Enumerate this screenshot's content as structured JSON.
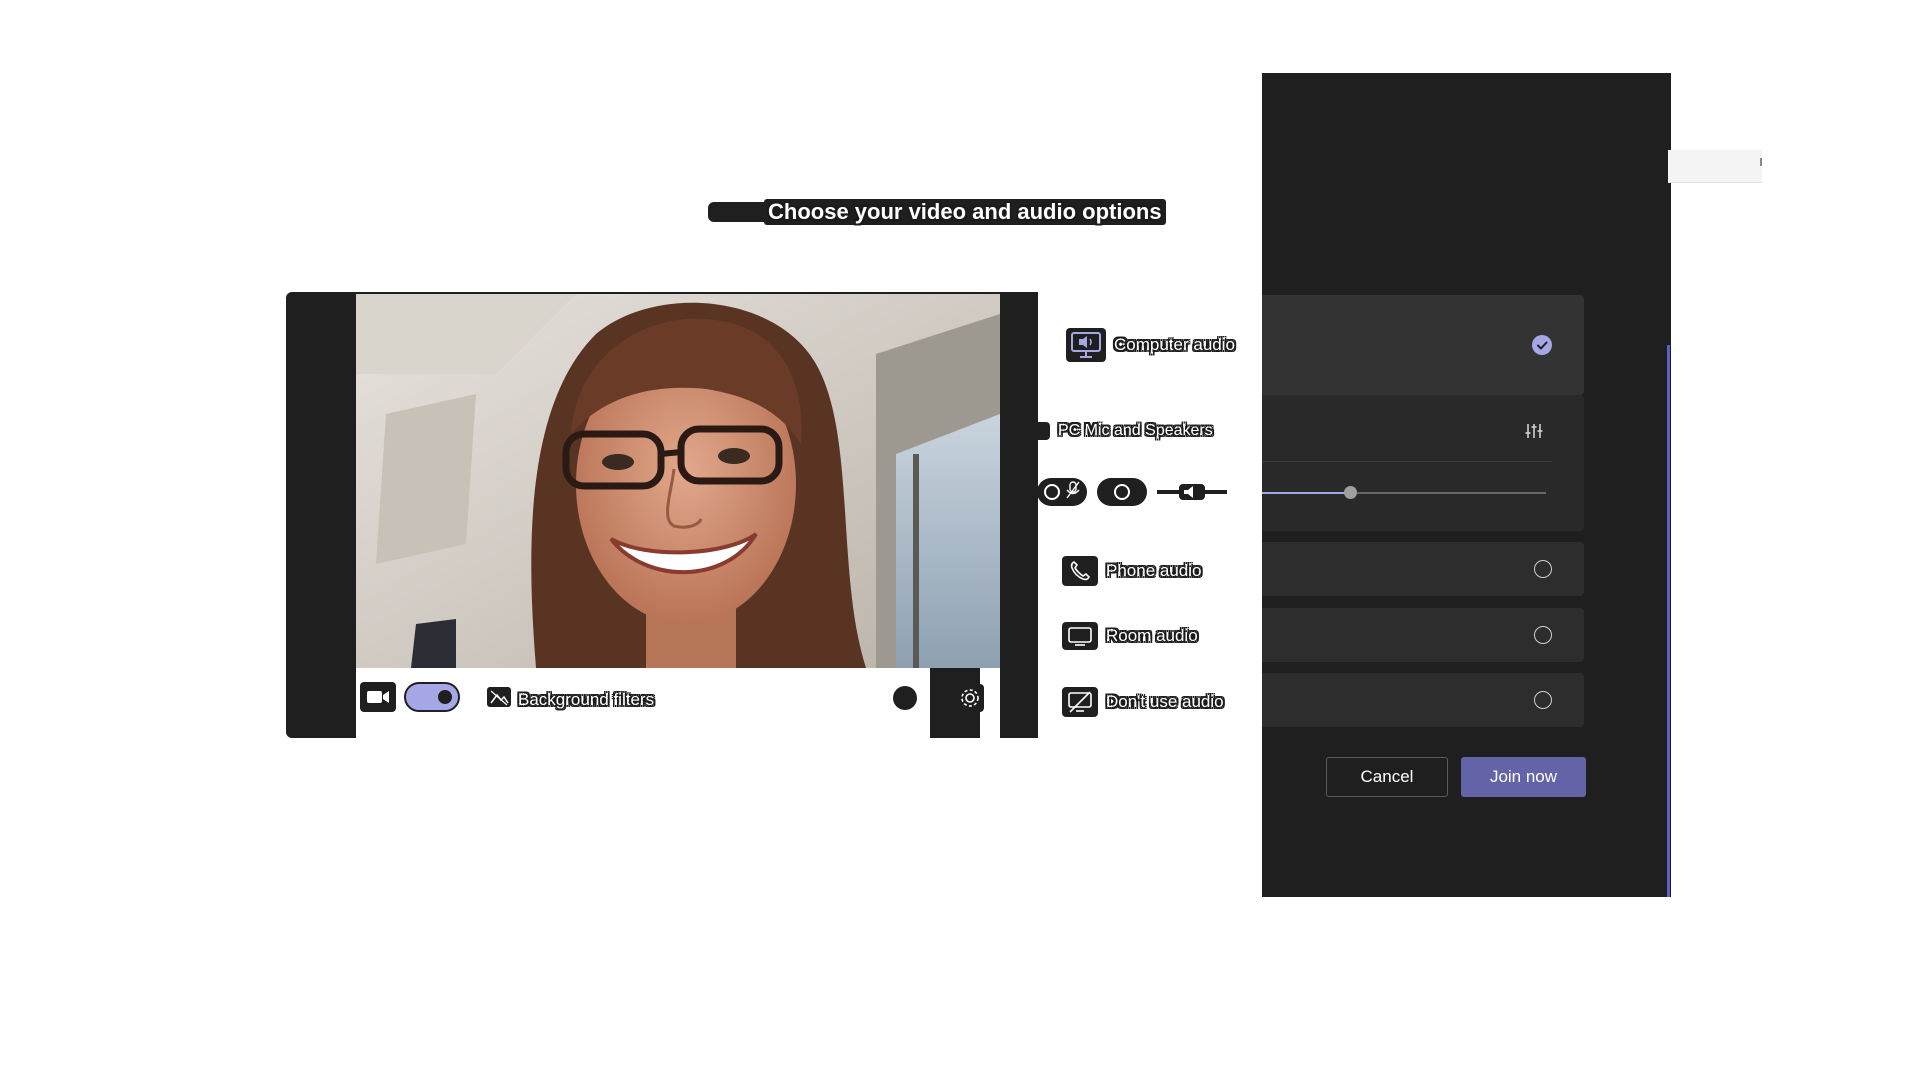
{
  "title": "Choose your video and audio options",
  "video": {
    "background_filters_label": "Background filters",
    "camera_on": true
  },
  "audio_options": {
    "computer_audio": {
      "label": "Computer audio",
      "selected": true
    },
    "device_label": "PC Mic and Speakers",
    "volume_level": 0.31,
    "phone_audio": {
      "label": "Phone audio",
      "selected": false
    },
    "room_audio": {
      "label": "Room audio",
      "selected": false
    },
    "no_audio": {
      "label": "Don't use audio",
      "selected": false
    }
  },
  "actions": {
    "cancel_label": "Cancel",
    "join_label": "Join now"
  },
  "colors": {
    "accent": "#6264a7",
    "accent_light": "#a6a8e6",
    "panel_bg": "#1f1f1f"
  },
  "icons": [
    "video-camera-icon",
    "background-filter-icon",
    "gear-icon",
    "speaker-monitor-icon",
    "mixer-icon",
    "mic-off-icon",
    "volume-icon",
    "phone-icon",
    "room-monitor-icon",
    "no-audio-icon",
    "check-icon"
  ]
}
